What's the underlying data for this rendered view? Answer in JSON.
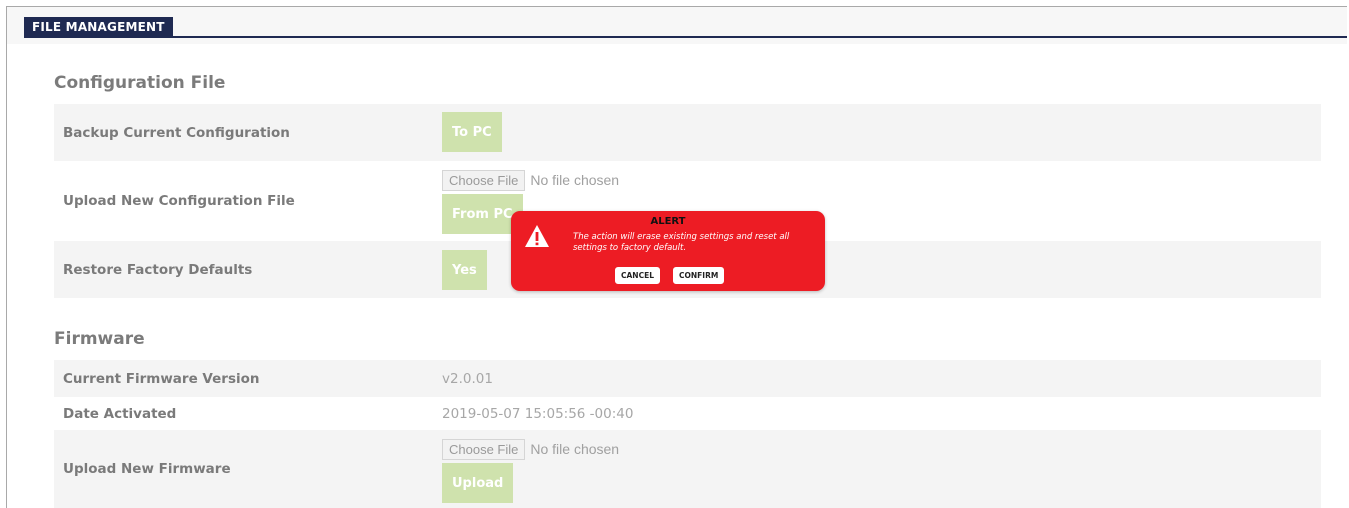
{
  "panel": {
    "title": "FILE MANAGEMENT"
  },
  "config_section": {
    "title": "Configuration File",
    "backup": {
      "label": "Backup Current Configuration",
      "button": "To PC"
    },
    "upload": {
      "label": "Upload New Configuration File",
      "file_button": "Choose File",
      "file_status": "No file chosen",
      "button": "From PC"
    },
    "restore": {
      "label": "Restore Factory Defaults",
      "button": "Yes"
    }
  },
  "firmware_section": {
    "title": "Firmware",
    "current_version": {
      "label": "Current Firmware Version",
      "value": "v2.0.01"
    },
    "date_activated": {
      "label": "Date Activated",
      "value": "2019-05-07 15:05:56 -00:40"
    },
    "upload": {
      "label": "Upload New Firmware",
      "file_button": "Choose File",
      "file_status": "No file chosen",
      "button": "Upload"
    }
  },
  "alert": {
    "title": "ALERT",
    "message": "The action will erase existing settings and reset all settings to factory default.",
    "cancel": "CANCEL",
    "confirm": "CONFIRM",
    "icon": "warning-triangle-icon"
  },
  "colors": {
    "panel_tab": "#1f2a52",
    "button_disabled_green": "#cfe2ad",
    "alert_red": "#ed1c24",
    "row_shade": "#f4f4f4"
  }
}
